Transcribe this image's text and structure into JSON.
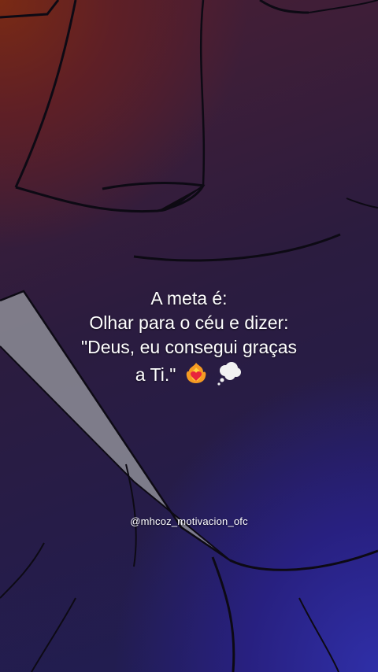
{
  "quote": {
    "line1": "A meta é:",
    "line2": "Olhar para o céu e dizer:",
    "line3": "\"Deus, eu consegui graças",
    "line4": "a Ti.\""
  },
  "icons": [
    "heart-on-fire-icon",
    "thought-balloon-icon"
  ],
  "watermark": {
    "handle": "@mhcoz_motivacion_ofc"
  }
}
